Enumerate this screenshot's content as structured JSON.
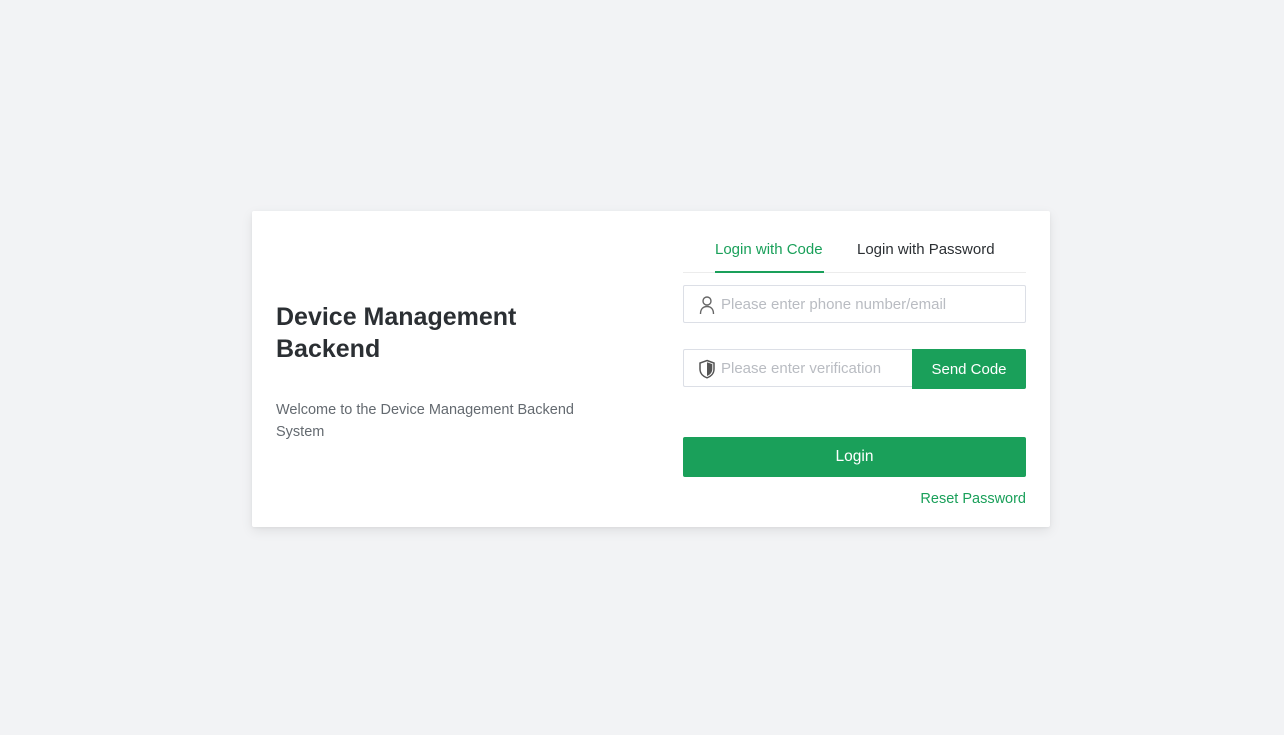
{
  "brand": {
    "title": "Device Management Backend",
    "subtitle": "Welcome to the Device Management Backend System"
  },
  "tabs": [
    {
      "label": "Login with Code",
      "active": true
    },
    {
      "label": "Login with Password",
      "active": false
    }
  ],
  "form": {
    "account": {
      "placeholder": "Please enter phone number/email",
      "value": "",
      "icon": "user-icon"
    },
    "code": {
      "placeholder": "Please enter verification code",
      "value": "",
      "icon": "shield-icon"
    },
    "send_code_label": "Send Code",
    "login_label": "Login",
    "reset_label": "Reset Password"
  },
  "colors": {
    "accent": "#1aa05a",
    "background": "#f2f3f5",
    "card": "#ffffff",
    "title": "#2b2f33",
    "muted": "#646a70",
    "placeholder": "#b9bcc2"
  }
}
